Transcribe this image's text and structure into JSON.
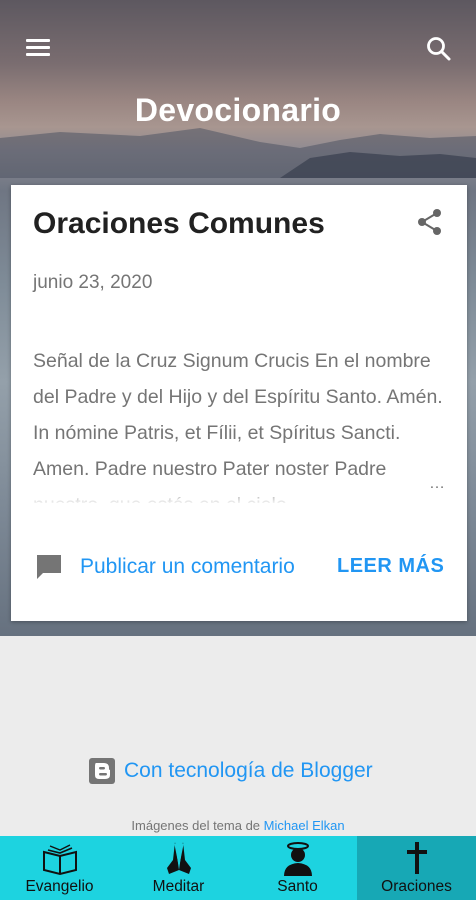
{
  "app": {
    "blog_title": "Devocionario"
  },
  "toolbar": {
    "menu_icon": "menu-icon",
    "search_icon": "search-icon"
  },
  "post": {
    "title": "Oraciones Comunes",
    "date": "junio 23, 2020",
    "snippet": "Señal de la Cruz Signum Crucis En el nombre del Padre y del Hijo y del Espíritu Santo. Amén. In nómine Patris, et Fílii, et Spíritus Sancti. Amen. Padre nuestro Pater noster Padre nuestro, que estás en el cielo",
    "ellipsis": "…",
    "comment_label": "Publicar un comentario",
    "read_more_label": "LEER MÁS"
  },
  "footer": {
    "blogger_label": "Con tecnología de Blogger",
    "credits_prefix": "Imágenes del tema de ",
    "credits_author": "Michael Elkan"
  },
  "tabs": [
    {
      "label": "Evangelio",
      "icon": "book-icon"
    },
    {
      "label": "Meditar",
      "icon": "praying-hands-icon"
    },
    {
      "label": "Santo",
      "icon": "saint-icon"
    },
    {
      "label": "Oraciones",
      "icon": "cross-icon"
    }
  ],
  "colors": {
    "link": "#2196f3",
    "tabbar": "#1dd3e0",
    "tab_active": "#17a8b5"
  }
}
